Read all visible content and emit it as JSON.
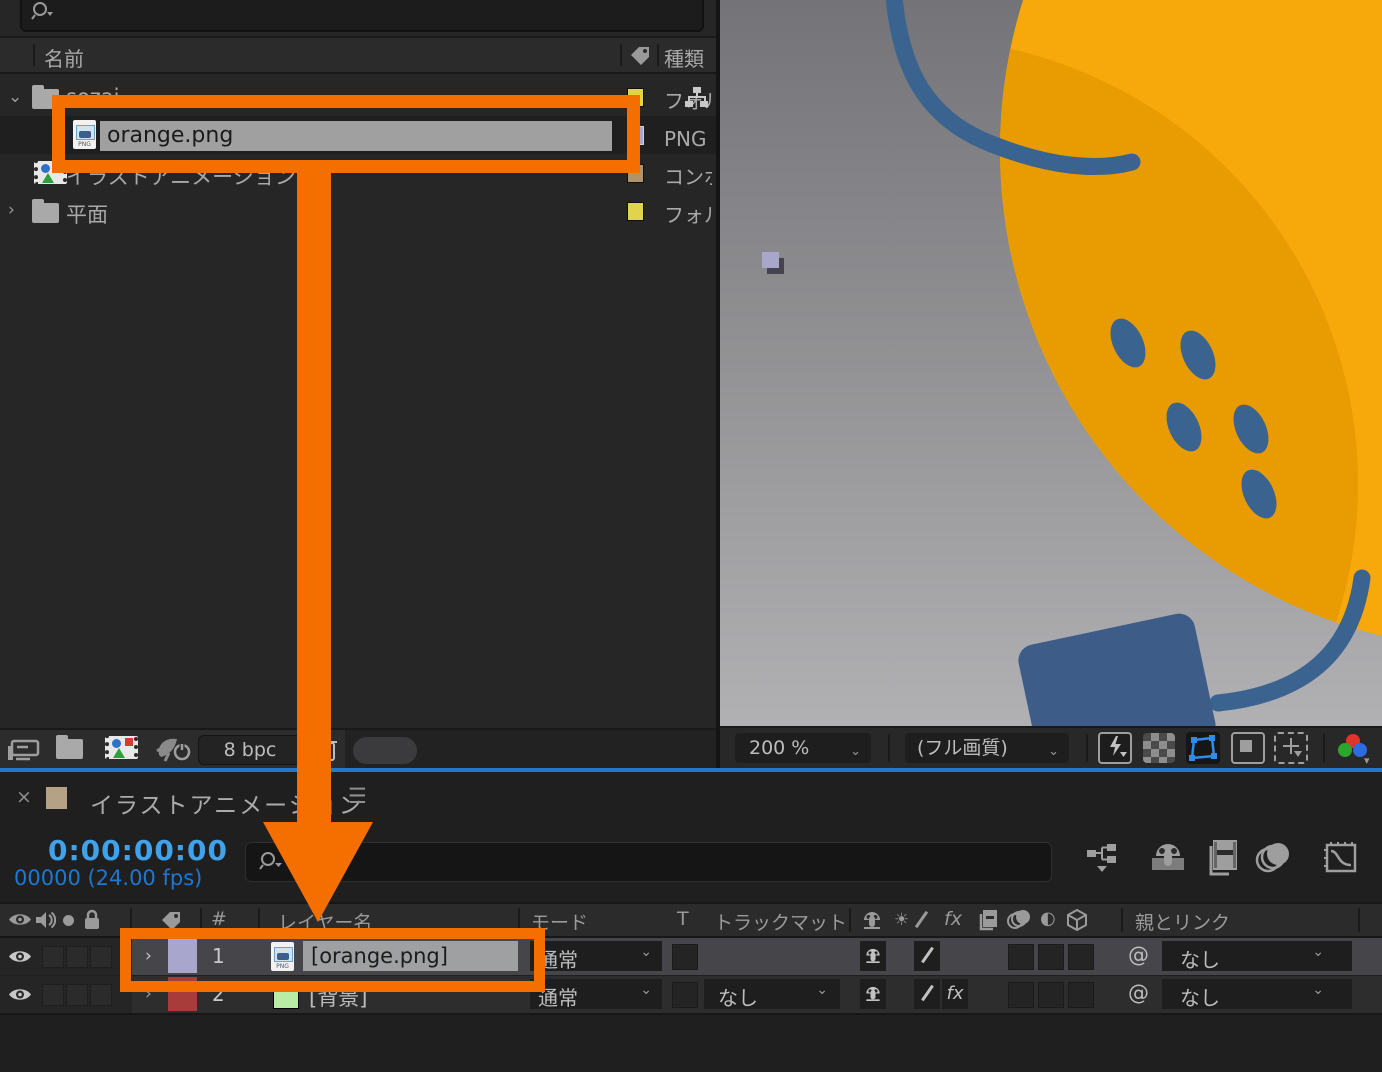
{
  "project": {
    "columns": {
      "name": "名前",
      "type": "種類"
    },
    "items": [
      {
        "name": "sozai",
        "type": "フォルダー",
        "label_color": "#E0D34D"
      },
      {
        "name": "orange.png",
        "type": "PNG ファイル",
        "label_color": "#A9A6CE"
      },
      {
        "name": "イラストアニメーション",
        "type": "コンポジション",
        "label_color": "#AE9468"
      },
      {
        "name": "平面",
        "type": "フォルダー",
        "label_color": "#E0D34D"
      }
    ],
    "footer": {
      "bpc": "8 bpc"
    }
  },
  "viewer": {
    "zoom": "200 %",
    "quality": "(フル画質)"
  },
  "timeline": {
    "tab": {
      "title": "イラストアニメーション"
    },
    "timecode": "0:00:00:00",
    "frames": "00000 (24.00 fps)",
    "columns": {
      "number": "#",
      "layer_name": "レイヤー名",
      "mode": "モード",
      "t": "T",
      "track_matte": "トラックマット",
      "parent": "親とリンク"
    },
    "layers": [
      {
        "number": "1",
        "name": "[orange.png]",
        "mode": "通常",
        "parent": "なし"
      },
      {
        "number": "2",
        "name": "[背景]",
        "mode": "通常",
        "matte": "なし",
        "parent": "なし"
      }
    ]
  },
  "annotation": {
    "color": "#F56F00"
  }
}
